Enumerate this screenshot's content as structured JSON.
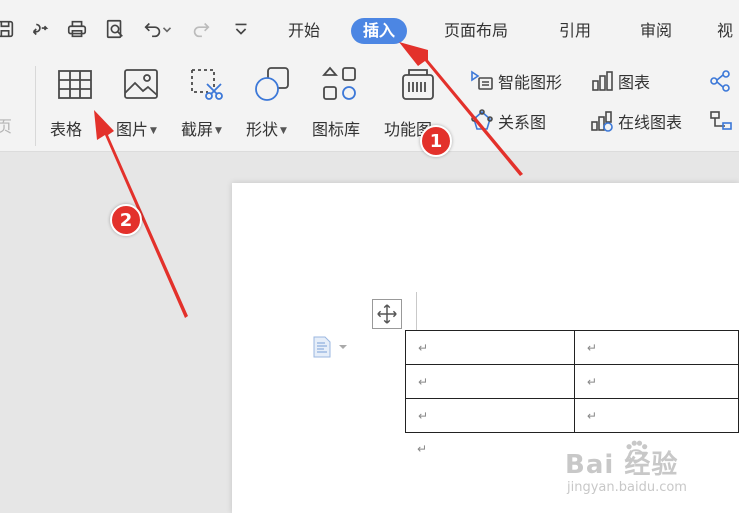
{
  "menu": {
    "tabs": [
      {
        "label": "开始",
        "active": false
      },
      {
        "label": "插入",
        "active": true
      },
      {
        "label": "页面布局",
        "active": false
      },
      {
        "label": "引用",
        "active": false
      },
      {
        "label": "审阅",
        "active": false
      },
      {
        "label": "视",
        "active": false
      }
    ]
  },
  "ribbon": {
    "cut_left_label": "页",
    "large": [
      {
        "label": "表格",
        "dropdown": false,
        "icon": "table-icon"
      },
      {
        "label": "图片",
        "dropdown": true,
        "icon": "picture-icon"
      },
      {
        "label": "截屏",
        "dropdown": true,
        "icon": "screenshot-icon"
      },
      {
        "label": "形状",
        "dropdown": true,
        "icon": "shapes-icon"
      },
      {
        "label": "图标库",
        "dropdown": false,
        "icon": "icon-library-icon"
      },
      {
        "label": "功能图",
        "dropdown": true,
        "icon": "function-chart-icon"
      }
    ],
    "small": [
      {
        "label": "智能图形",
        "icon": "smart-art-icon"
      },
      {
        "label": "图表",
        "icon": "chart-icon"
      },
      {
        "label": "关系图",
        "icon": "relation-graph-icon"
      },
      {
        "label": "在线图表",
        "icon": "online-chart-icon"
      }
    ]
  },
  "document": {
    "cell_mark": "↵",
    "rows": [
      [
        "↵",
        "↵"
      ],
      [
        "↵",
        "↵"
      ],
      [
        "↵",
        "↵"
      ]
    ],
    "after_table_mark": "↵"
  },
  "annotations": {
    "badge1": "1",
    "badge2": "2",
    "color": "#e3312b"
  },
  "watermark": {
    "title": "Bai  经验",
    "url": "jingyan.baidu.com"
  },
  "colors": {
    "accent": "#4c86e3",
    "ribbon_bg": "#f3f3f3",
    "workspace_bg": "#e6e6e6",
    "icon_stroke": "#4a4a4a"
  }
}
